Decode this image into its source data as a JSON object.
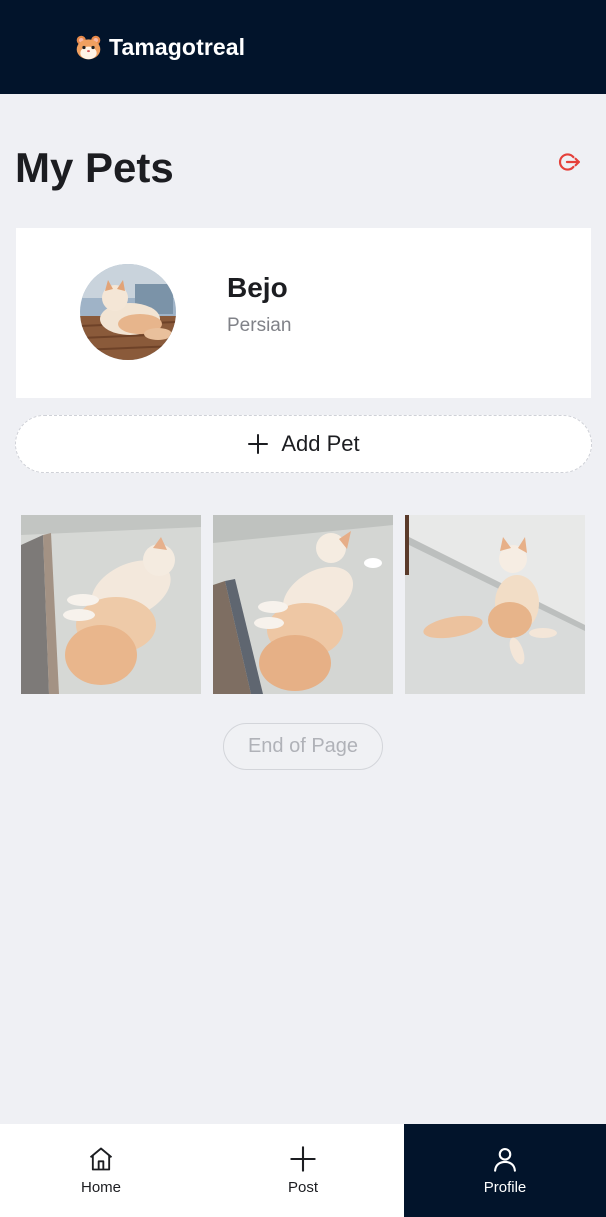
{
  "app": {
    "name": "Tamagotreal",
    "logo_icon": "hamster-icon"
  },
  "page": {
    "title": "My Pets",
    "logout_icon": "logout-icon",
    "accent_color": "#e5403a"
  },
  "pets": [
    {
      "name": "Bejo",
      "breed": "Persian",
      "avatar": "persian-cat-photo"
    }
  ],
  "add_pet": {
    "label": "Add Pet",
    "icon": "plus-icon"
  },
  "gallery": [
    {
      "image": "cat-lying-photo-1"
    },
    {
      "image": "cat-lying-photo-2"
    },
    {
      "image": "cat-sitting-photo"
    }
  ],
  "end_of_page": "End of Page",
  "bottom_nav": {
    "items": [
      {
        "label": "Home",
        "icon": "home-icon",
        "active": false
      },
      {
        "label": "Post",
        "icon": "plus-icon",
        "active": false
      },
      {
        "label": "Profile",
        "icon": "user-icon",
        "active": true
      }
    ]
  },
  "colors": {
    "header_bg": "#02142b",
    "page_bg": "#eff0f4",
    "card_bg": "#ffffff"
  }
}
